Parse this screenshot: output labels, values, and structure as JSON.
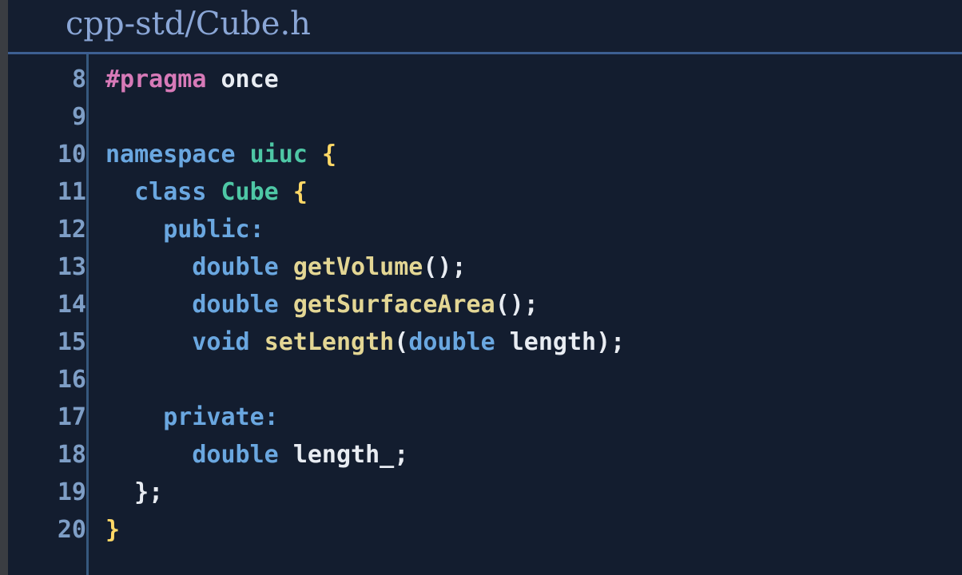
{
  "header": {
    "title": "cpp-std/Cube.h"
  },
  "editor": {
    "lines": [
      {
        "num": "8",
        "tokens": [
          {
            "t": "#pragma",
            "c": "pp"
          },
          {
            "t": " ",
            "c": "pu"
          },
          {
            "t": "once",
            "c": "id"
          }
        ]
      },
      {
        "num": "9",
        "tokens": []
      },
      {
        "num": "10",
        "tokens": [
          {
            "t": "namespace",
            "c": "kw"
          },
          {
            "t": " ",
            "c": "pu"
          },
          {
            "t": "uiuc",
            "c": "ty"
          },
          {
            "t": " ",
            "c": "pu"
          },
          {
            "t": "{",
            "c": "br"
          }
        ]
      },
      {
        "num": "11",
        "tokens": [
          {
            "t": "  ",
            "c": "pu"
          },
          {
            "t": "class",
            "c": "kw"
          },
          {
            "t": " ",
            "c": "pu"
          },
          {
            "t": "Cube",
            "c": "ty"
          },
          {
            "t": " ",
            "c": "pu"
          },
          {
            "t": "{",
            "c": "br"
          }
        ]
      },
      {
        "num": "12",
        "tokens": [
          {
            "t": "    ",
            "c": "pu"
          },
          {
            "t": "public:",
            "c": "kw"
          }
        ]
      },
      {
        "num": "13",
        "tokens": [
          {
            "t": "      ",
            "c": "pu"
          },
          {
            "t": "double",
            "c": "kw"
          },
          {
            "t": " ",
            "c": "pu"
          },
          {
            "t": "getVolume",
            "c": "fn"
          },
          {
            "t": "();",
            "c": "pu"
          }
        ]
      },
      {
        "num": "14",
        "tokens": [
          {
            "t": "      ",
            "c": "pu"
          },
          {
            "t": "double",
            "c": "kw"
          },
          {
            "t": " ",
            "c": "pu"
          },
          {
            "t": "getSurfaceArea",
            "c": "fn"
          },
          {
            "t": "();",
            "c": "pu"
          }
        ]
      },
      {
        "num": "15",
        "tokens": [
          {
            "t": "      ",
            "c": "pu"
          },
          {
            "t": "void",
            "c": "kw"
          },
          {
            "t": " ",
            "c": "pu"
          },
          {
            "t": "setLength",
            "c": "fn"
          },
          {
            "t": "(",
            "c": "pu"
          },
          {
            "t": "double",
            "c": "kw"
          },
          {
            "t": " ",
            "c": "pu"
          },
          {
            "t": "length",
            "c": "id"
          },
          {
            "t": ");",
            "c": "pu"
          }
        ]
      },
      {
        "num": "16",
        "tokens": []
      },
      {
        "num": "17",
        "tokens": [
          {
            "t": "    ",
            "c": "pu"
          },
          {
            "t": "private:",
            "c": "kw"
          }
        ]
      },
      {
        "num": "18",
        "tokens": [
          {
            "t": "      ",
            "c": "pu"
          },
          {
            "t": "double",
            "c": "kw"
          },
          {
            "t": " ",
            "c": "pu"
          },
          {
            "t": "length_",
            "c": "id"
          },
          {
            "t": ";",
            "c": "pu"
          }
        ]
      },
      {
        "num": "19",
        "tokens": [
          {
            "t": "  ",
            "c": "pu"
          },
          {
            "t": "};",
            "c": "pu"
          }
        ]
      },
      {
        "num": "20",
        "tokens": [
          {
            "t": "}",
            "c": "br"
          }
        ]
      }
    ]
  },
  "colors": {
    "background": "#131d2f",
    "keyword": "#6aa7e0",
    "preprocessor": "#d77ab8",
    "type": "#4ec7a5",
    "function": "#e3d694",
    "identifier": "#e8ecf2",
    "line_number": "#7e9ec6",
    "title": "#8aa6d6"
  }
}
